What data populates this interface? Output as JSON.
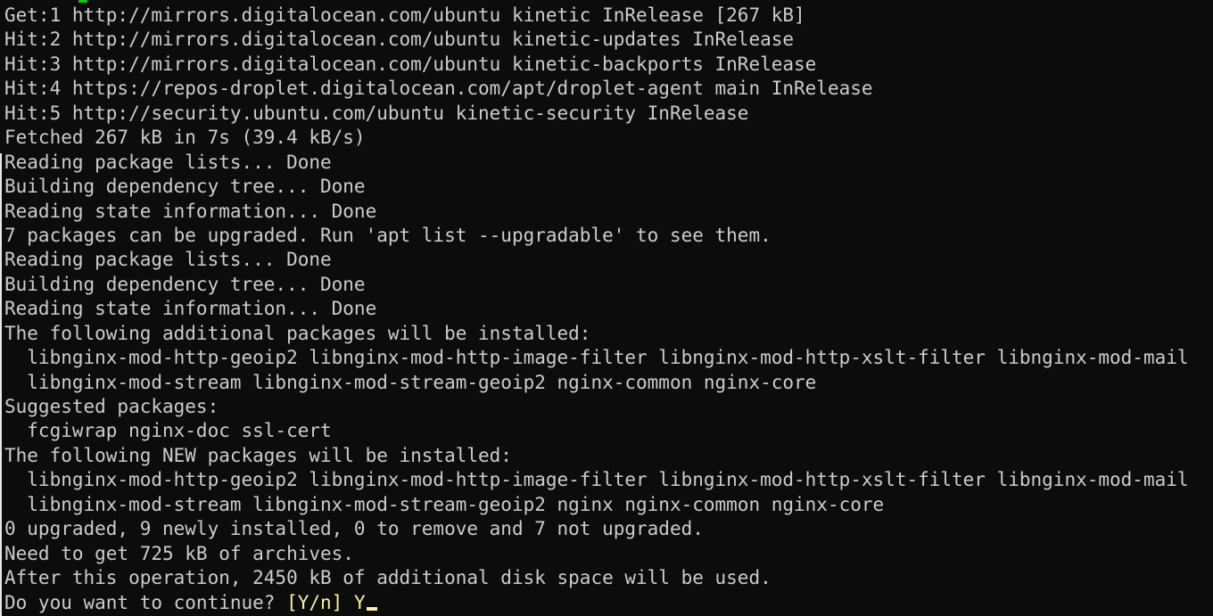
{
  "terminal": {
    "lines": [
      "Get:1 http://mirrors.digitalocean.com/ubuntu kinetic InRelease [267 kB]",
      "Hit:2 http://mirrors.digitalocean.com/ubuntu kinetic-updates InRelease",
      "Hit:3 http://mirrors.digitalocean.com/ubuntu kinetic-backports InRelease",
      "Hit:4 https://repos-droplet.digitalocean.com/apt/droplet-agent main InRelease",
      "Hit:5 http://security.ubuntu.com/ubuntu kinetic-security InRelease",
      "Fetched 267 kB in 7s (39.4 kB/s)",
      "Reading package lists... Done",
      "Building dependency tree... Done",
      "Reading state information... Done",
      "7 packages can be upgraded. Run 'apt list --upgradable' to see them.",
      "Reading package lists... Done",
      "Building dependency tree... Done",
      "Reading state information... Done",
      "The following additional packages will be installed:",
      "  libnginx-mod-http-geoip2 libnginx-mod-http-image-filter libnginx-mod-http-xslt-filter libnginx-mod-mail",
      "  libnginx-mod-stream libnginx-mod-stream-geoip2 nginx-common nginx-core",
      "Suggested packages:",
      "  fcgiwrap nginx-doc ssl-cert",
      "The following NEW packages will be installed:",
      "  libnginx-mod-http-geoip2 libnginx-mod-http-image-filter libnginx-mod-http-xslt-filter libnginx-mod-mail",
      "  libnginx-mod-stream libnginx-mod-stream-geoip2 nginx nginx-common nginx-core",
      "0 upgraded, 9 newly installed, 0 to remove and 7 not upgraded.",
      "Need to get 725 kB of archives.",
      "After this operation, 2450 kB of additional disk space will be used."
    ],
    "prompt": {
      "question": "Do you want to continue? ",
      "options": "[Y/n]",
      "answer": " Y"
    },
    "colors": {
      "background": "#0c0c0c",
      "text": "#cccccc",
      "prompt_highlight": "#f9f1a5",
      "top_fragment": "#16c60c"
    }
  }
}
